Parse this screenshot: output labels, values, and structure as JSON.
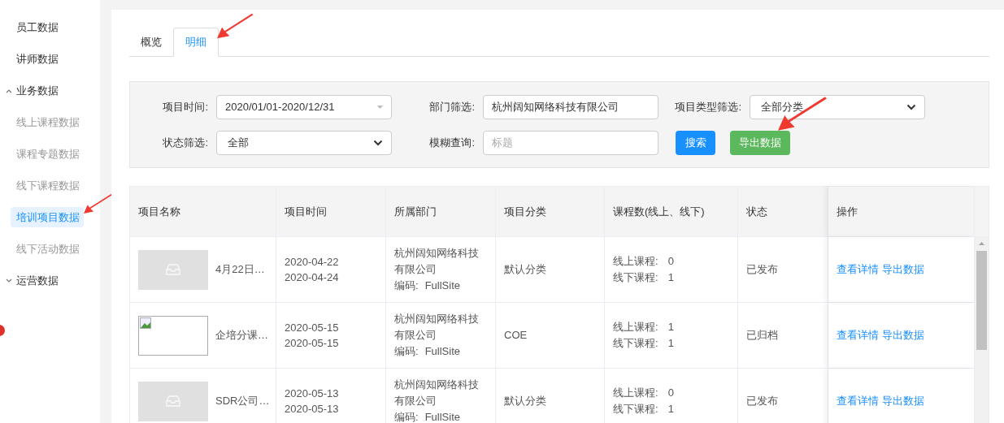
{
  "sidebar": {
    "items": [
      {
        "kind": "item",
        "label": "员工数据",
        "selected": false
      },
      {
        "kind": "item",
        "label": "讲师数据",
        "selected": false
      },
      {
        "kind": "group",
        "label": "业务数据",
        "expanded": true,
        "children": [
          {
            "label": "线上课程数据",
            "selected": false
          },
          {
            "label": "课程专题数据",
            "selected": false
          },
          {
            "label": "线下课程数据",
            "selected": false
          },
          {
            "label": "培训项目数据",
            "selected": true
          },
          {
            "label": "线下活动数据",
            "selected": false
          }
        ]
      },
      {
        "kind": "group",
        "label": "运营数据",
        "expanded": false
      }
    ]
  },
  "tabs": [
    {
      "label": "概览",
      "selected": false
    },
    {
      "label": "明细",
      "selected": true
    }
  ],
  "filters": {
    "row1": [
      {
        "kind": "daterange",
        "label": "项目时间:",
        "value": "2020/01/01-2020/12/31"
      },
      {
        "kind": "input",
        "label": "部门筛选:",
        "value": "杭州阔知网络科技有限公司"
      },
      {
        "kind": "select",
        "label": "项目类型筛选:",
        "value": "全部分类"
      }
    ],
    "row2": [
      {
        "kind": "select",
        "label": "状态筛选:",
        "value": "全部"
      },
      {
        "kind": "input",
        "label": "模糊查询:",
        "placeholder": "标题"
      }
    ],
    "buttons": [
      {
        "label": "搜索",
        "kind": "primary"
      },
      {
        "label": "导出数据",
        "kind": "success"
      }
    ]
  },
  "table": {
    "columns": [
      "项目名称",
      "项目时间",
      "所属部门",
      "项目分类",
      "课程数(线上、线下)",
      "状态",
      "操作"
    ],
    "rows": [
      {
        "thumbnail": {
          "kind": "placeholder"
        },
        "name": "4月22日…",
        "start": "2020-04-22",
        "end": "2020-04-24",
        "dept": "杭州阔知网络科技有限公司",
        "code_label": "编码:",
        "code": "FullSite",
        "category": "默认分类",
        "online_label": "线上课程:",
        "online": "0",
        "offline_label": "线下课程:",
        "offline": "1",
        "status": "已发布",
        "actions": [
          "查看详情",
          "导出数据"
        ]
      },
      {
        "thumbnail": {
          "kind": "broken"
        },
        "name": "企培分课…",
        "start": "2020-05-15",
        "end": "2020-05-15",
        "dept": "杭州阔知网络科技有限公司",
        "code_label": "编码:",
        "code": "FullSite",
        "category": "COE",
        "online_label": "线上课程:",
        "online": "1",
        "offline_label": "线下课程:",
        "offline": "1",
        "status": "已归档",
        "actions": [
          "查看详情",
          "导出数据"
        ]
      },
      {
        "thumbnail": {
          "kind": "placeholder"
        },
        "name": "SDR公司…",
        "start": "2020-05-13",
        "end": "2020-05-13",
        "dept": "杭州阔知网络科技有限公司",
        "code_label": "编码:",
        "code": "FullSite",
        "category": "默认分类",
        "online_label": "线上课程:",
        "online": "0",
        "offline_label": "线下课程:",
        "offline": "1",
        "status": "已发布",
        "actions": [
          "查看详情",
          "导出数据"
        ]
      }
    ]
  }
}
